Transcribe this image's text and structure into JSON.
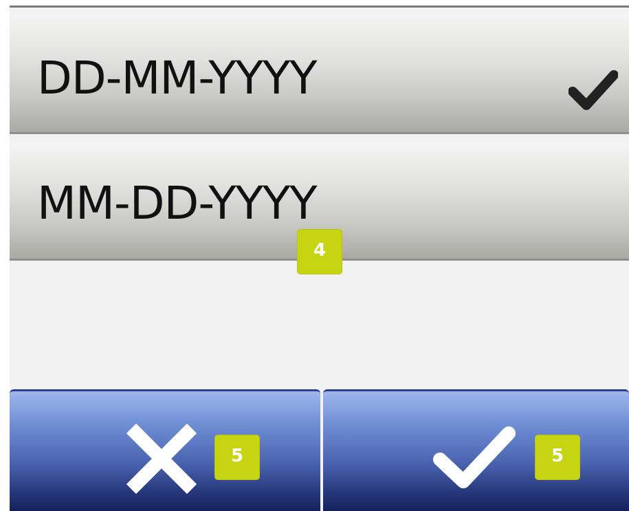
{
  "date_formats": [
    {
      "label": "DD-MM-YYYY",
      "selected": true
    },
    {
      "label": "MM-DD-YYYY",
      "selected": false
    }
  ],
  "callouts": {
    "option_list": "4",
    "cancel": "5",
    "confirm": "5"
  },
  "icons": {
    "selected": "checkmark-icon",
    "cancel": "close-icon",
    "confirm": "checkmark-icon"
  },
  "colors": {
    "callout_badge": "#c6d412",
    "action_button": "#4a63b1",
    "option_background": "#d8d8d5"
  }
}
